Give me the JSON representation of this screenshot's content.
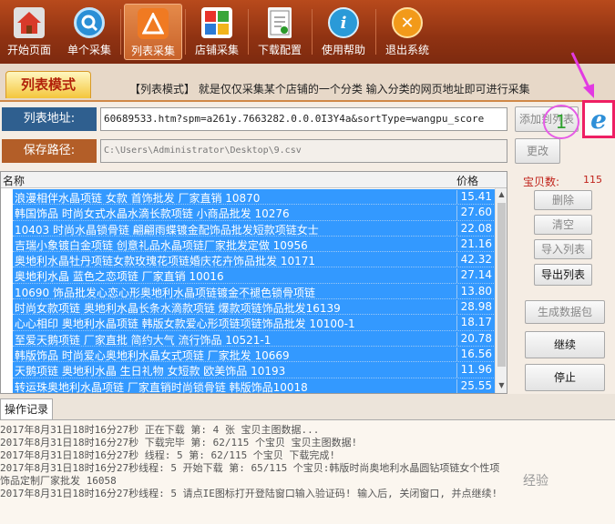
{
  "toolbar": {
    "items": [
      {
        "label": "开始页面",
        "icon": "home-icon"
      },
      {
        "label": "单个采集",
        "icon": "search-icon"
      },
      {
        "label": "列表采集",
        "icon": "list-collect-icon"
      },
      {
        "label": "店铺采集",
        "icon": "shop-icon"
      },
      {
        "label": "下载配置",
        "icon": "download-config-icon"
      },
      {
        "label": "使用帮助",
        "icon": "help-icon"
      },
      {
        "label": "退出系统",
        "icon": "exit-icon"
      }
    ],
    "active": "列表采集"
  },
  "mode": {
    "tab_label": "列表模式",
    "description": "【列表模式】 就是仅仅采集某个店铺的一个分类  输入分类的网页地址即可进行采集"
  },
  "address": {
    "label": "列表地址:",
    "value": "60689533.htm?spm=a261y.7663282.0.0.0I3Y4a&sortType=wangpu_score",
    "add_button": "添加到列表"
  },
  "save_path": {
    "label": "保存路径:",
    "value": "C:\\Users\\Administrator\\Desktop\\9.csv",
    "change_button": "更改"
  },
  "table": {
    "col_name": "名称",
    "col_price": "价格",
    "rows": [
      {
        "name": "浪漫相伴水晶项链 女款 首饰批发 厂家直销 10870",
        "price": "15.41"
      },
      {
        "name": "韩国饰品 时尚女式水晶水滴长款项链 小商品批发 10276",
        "price": "27.60"
      },
      {
        "name": "10403 时尚水晶锁骨链 翩翩雨蝶镀金配饰品批发短款项链女士",
        "price": "22.08"
      },
      {
        "name": "吉瑞小象镀白金项链 创意礼品水晶项链厂家批发定做 10956",
        "price": "21.16"
      },
      {
        "name": "奥地利水晶牡丹项链女款玫瑰花项链婚庆花卉饰品批发 10171",
        "price": "42.32"
      },
      {
        "name": "奥地利水晶 蓝色之恋项链 厂家直销 10016",
        "price": "27.14"
      },
      {
        "name": "10690 饰品批发心恋心形奥地利水晶项链镀金不褪色锁骨项链",
        "price": "13.80"
      },
      {
        "name": "时尚女款项链 奥地利水晶长条水滴款项链 爆款项链饰品批发16139",
        "price": "28.98"
      },
      {
        "name": "心心相印 奥地利水晶项链 韩版女款爱心形项链项链饰品批发 10100-1",
        "price": "18.17"
      },
      {
        "name": "至爱天鹅项链 厂家直批 简约大气 流行饰品 10521-1",
        "price": "20.78"
      },
      {
        "name": "韩版饰品 时尚爱心奥地利水晶女式项链 厂家批发 10669",
        "price": "16.56"
      },
      {
        "name": "天鹅项链 奥地利水晶 生日礼物 女短款 欧美饰品 10193",
        "price": "11.96"
      },
      {
        "name": "转运珠奥地利水晶项链 厂家直销时尚锁骨链 韩版饰品10018",
        "price": "25.55"
      }
    ]
  },
  "panel": {
    "count_label": "宝贝数:",
    "count_value": "115",
    "delete": "删除",
    "clear": "清空",
    "import": "导入列表",
    "export": "导出列表",
    "generate": "生成数据包",
    "continue": "继续",
    "stop": "停止"
  },
  "log": {
    "tab_label": "操作记录",
    "lines": [
      "2017年8月31日18时16分27秒  正在下载 第: 4  张 宝贝主图数据...",
      "2017年8月31日18时16分27秒  下载完毕 第: 62/115  个宝贝  宝贝主图数据!",
      "2017年8月31日18时16分27秒 线程: 5 第: 62/115 个宝贝 下载完成!",
      "2017年8月31日18时16分27秒线程: 5  开始下载 第: 65/115 个宝贝:韩版时尚奥地利水晶圆钻项链女个性项",
      "饰品定制厂家批发 16058",
      "2017年8月31日18时16分27秒线程: 5  请点IE图标打开登陆窗口输入验证码! 输入后, 关闭窗口, 并点继续!"
    ]
  },
  "overlay": {
    "circle_number": "1",
    "watermark": "经验",
    "ie_icon": "ie-browser-icon"
  },
  "colors": {
    "toolbar": "#8f3212",
    "selection": "#3399ff",
    "highlight": "#ee1f63",
    "circle": "#e65ae6"
  }
}
